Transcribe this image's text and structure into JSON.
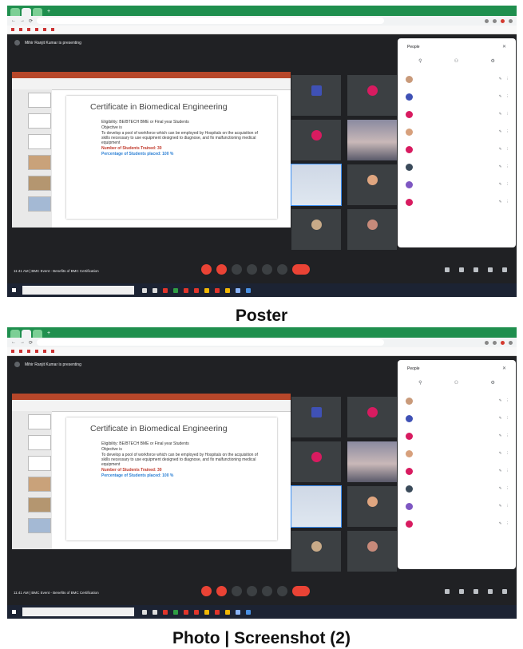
{
  "screens": [
    {
      "presenting": "Mihir Ranjit Kumar is presenting",
      "slide": {
        "title": "Certificate in Biomedical Engineering",
        "bullets": [
          "Eligibility: BE/BTECH BME or Final year Students",
          "Objective is",
          "To develop a pool of workforce which can be employed by Hospitals on the acquisition of skills necessary to use equipment designed to diagnose, and fix malfunctioning medical equipment"
        ],
        "highlight_red": "Number of Students Trained: 30",
        "highlight_blue": "Percentage of Students placed: 100 %"
      },
      "meeting_clock": "11:41 AM | BMC Event - Benefits of BMC Certification",
      "people_panel": {
        "title": "People"
      }
    },
    {
      "presenting": "Mihir Ranjit Kumar is presenting",
      "slide": {
        "title": "Certificate in Biomedical Engineering",
        "bullets": [
          "Eligibility: BE/BTECH BME or Final year Students",
          "Objective is",
          "To develop a pool of workforce which can be employed by Hospitals on the acquisition of skills necessary to use equipment designed to diagnose, and fix malfunctioning medical equipment"
        ],
        "highlight_red": "Number of Students Trained: 30",
        "highlight_blue": "Percentage of Students placed: 100 %"
      },
      "meeting_clock": "11:41 AM | BMC Event - Benefits of BMC Certification",
      "people_panel": {
        "title": "People"
      }
    }
  ],
  "captions": {
    "top": "Poster",
    "bottom": "Photo | Screenshot (2)"
  },
  "colors": {
    "browser_frame": "#1f8f4e",
    "meet_bg": "#202124",
    "end_call": "#ea4335",
    "slide_red": "#c0392b",
    "slide_blue": "#2a7fd4"
  }
}
